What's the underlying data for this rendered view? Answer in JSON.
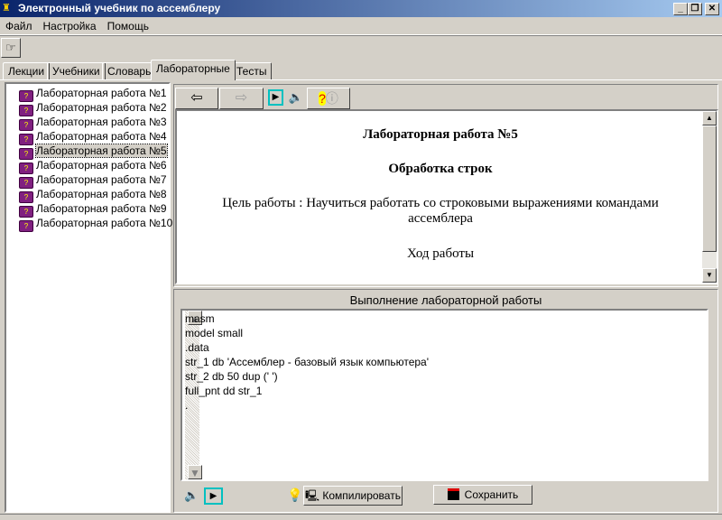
{
  "window": {
    "title": "Электронный учебник по ассемблеру",
    "minimize": "_",
    "restore": "❐",
    "close": "✕"
  },
  "menu": [
    "Файл",
    "Настройка",
    "Помощь"
  ],
  "tabs": [
    "Лекции",
    "Учебники",
    "Словарь",
    "Лабораторные",
    "Тесты"
  ],
  "active_tab": "Лабораторные",
  "tree": [
    "Лабораторная работа №1",
    "Лабораторная работа №2",
    "Лабораторная работа №3",
    "Лабораторная работа №4",
    "Лабораторная работа №5",
    "Лабораторная работа №6",
    "Лабораторная работа №7",
    "Лабораторная работа №8",
    "Лабораторная работа №9",
    "Лабораторная работа №10"
  ],
  "selected_item": "Лабораторная работа №5",
  "content": {
    "title": "Лабораторная работа №5",
    "subtitle": "Обработка строк",
    "goal": "Цель работы : Научиться работать со строковыми выражениями командами ассемблера",
    "progress": "Ход работы"
  },
  "exec": {
    "label": "Выполнение лабораторной работы",
    "code": [
      "masm",
      "model small",
      ".data",
      "str_1 db 'Ассемблер - базовый язык компьютера'",
      "str_2 db 50 dup (' ')",
      "full_pnt dd str_1",
      "."
    ]
  },
  "buttons": {
    "compile": "Компилировать",
    "save": "Сохранить"
  }
}
